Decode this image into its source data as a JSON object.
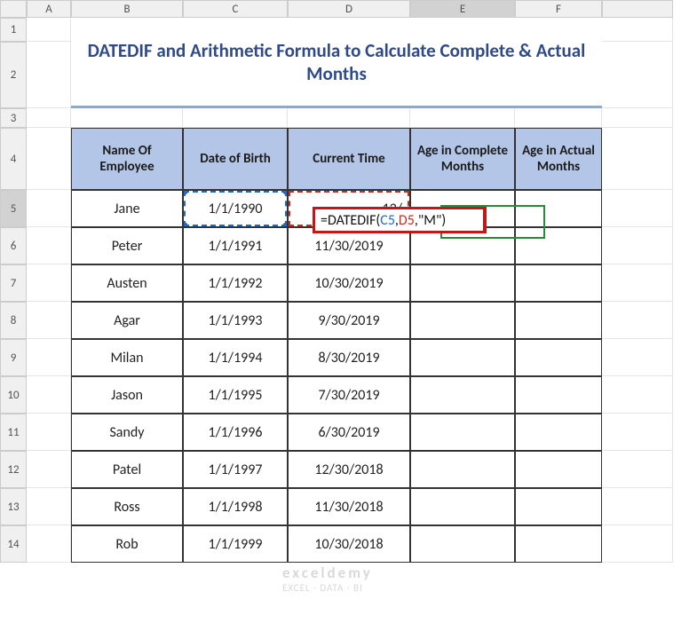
{
  "columns": [
    "A",
    "B",
    "C",
    "D",
    "E",
    "F"
  ],
  "rows": [
    "1",
    "2",
    "3",
    "4",
    "5",
    "6",
    "7",
    "8",
    "9",
    "10",
    "11",
    "12",
    "13",
    "14"
  ],
  "active_col": "E",
  "active_row": "5",
  "title": "DATEDIF and Arithmetic Formula to Calculate Complete & Actual Months",
  "headers": {
    "b": "Name Of Employee",
    "c": "Date of Birth",
    "d": "Current Time",
    "e": "Age in Complete Months",
    "f": "Age in Actual Months"
  },
  "data_rows": [
    {
      "name": "Jane",
      "dob": "1/1/1990",
      "cur": "12/"
    },
    {
      "name": "Peter",
      "dob": "1/1/1991",
      "cur": "11/30/2019"
    },
    {
      "name": "Austen",
      "dob": "1/1/1992",
      "cur": "10/30/2019"
    },
    {
      "name": "Agar",
      "dob": "1/1/1993",
      "cur": "9/30/2019"
    },
    {
      "name": "Milan",
      "dob": "1/1/1994",
      "cur": "8/30/2019"
    },
    {
      "name": "Jason",
      "dob": "1/1/1995",
      "cur": "7/30/2019"
    },
    {
      "name": "Sandy",
      "dob": "1/1/1996",
      "cur": "6/30/2019"
    },
    {
      "name": "Patel",
      "dob": "1/1/1997",
      "cur": "12/30/2018"
    },
    {
      "name": "Ross",
      "dob": "1/1/1998",
      "cur": "11/30/2018"
    },
    {
      "name": "Rob",
      "dob": "1/1/1999",
      "cur": "10/30/2018"
    }
  ],
  "formula": {
    "prefix": "=",
    "fn": "DATEDIF",
    "open": "(",
    "ref1": "C5",
    "comma1": ",",
    "ref2": "D5",
    "comma2": ",",
    "arg3": "\"M\"",
    "close": ")"
  },
  "watermark": {
    "line1": "exceldemy",
    "line2": "EXCEL · DATA · BI"
  }
}
